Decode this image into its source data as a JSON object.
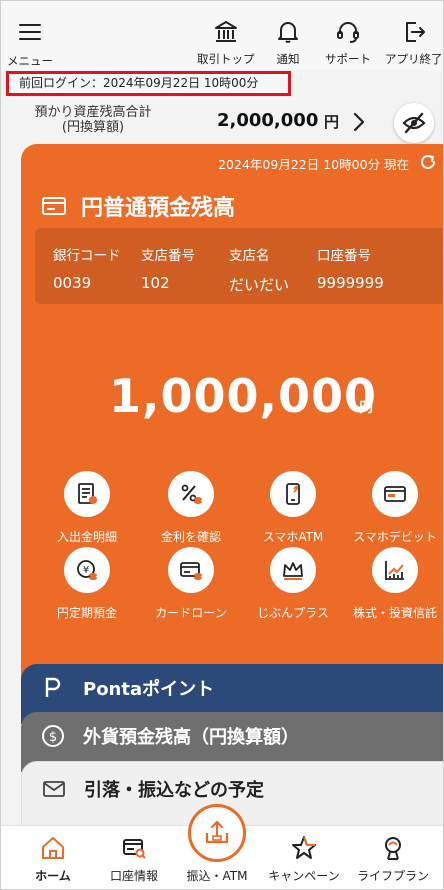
{
  "header": {
    "menu_label": "メニュー",
    "buttons": [
      {
        "label": "取引トップ",
        "icon": "bank-icon"
      },
      {
        "label": "通知",
        "icon": "bell-icon"
      },
      {
        "label": "サポート",
        "icon": "headset-icon"
      },
      {
        "label": "アプリ終了",
        "icon": "exit-icon"
      }
    ]
  },
  "last_login": "前回ログイン：2024年09月22日 10時00分",
  "total_balance": {
    "label_line1": "預かり資産残高合計",
    "label_line2": "(円換算額)",
    "amount": "2,000,000",
    "unit": "円"
  },
  "card": {
    "timestamp": "2024年09月22日 10時00分 現在",
    "title": "円普通預金残高",
    "bank_code_label": "銀行コード",
    "bank_code": "0039",
    "branch_no_label": "支店番号",
    "branch_no": "102",
    "branch_name_label": "支店名",
    "branch_name": "だいだい",
    "account_no_label": "口座番号",
    "account_no": "9999999",
    "balance": "1,000,000",
    "unit": "円",
    "actions": [
      {
        "label": "入出金明細",
        "icon": "statement-icon"
      },
      {
        "label": "金利を確認",
        "icon": "interest-icon"
      },
      {
        "label": "スマホATM",
        "icon": "smartphone-atm-icon"
      },
      {
        "label": "スマホデビット",
        "icon": "debit-card-icon"
      },
      {
        "label": "円定期預金",
        "icon": "time-deposit-icon"
      },
      {
        "label": "カードローン",
        "icon": "card-loan-icon"
      },
      {
        "label": "じぶんプラス",
        "icon": "crown-icon"
      },
      {
        "label": "株式・投資信託",
        "icon": "chart-icon"
      }
    ]
  },
  "stacked": {
    "ponta": "Pontaポイント",
    "forex": "外貨預金残高（円換算額）",
    "schedule": "引落・振込などの予定"
  },
  "bottom_nav": [
    {
      "label": "ホーム",
      "icon": "home-icon"
    },
    {
      "label": "口座情報",
      "icon": "account-info-icon"
    },
    {
      "label": "振込・ATM",
      "icon": "transfer-icon"
    },
    {
      "label": "キャンペーン",
      "icon": "star-icon"
    },
    {
      "label": "ライフプラン",
      "icon": "lifeplan-icon"
    }
  ],
  "colors": {
    "accent": "#ec6b27",
    "ponta": "#2b4a7a",
    "forex": "#6f6f6f",
    "highlight_border": "#e0141e"
  }
}
